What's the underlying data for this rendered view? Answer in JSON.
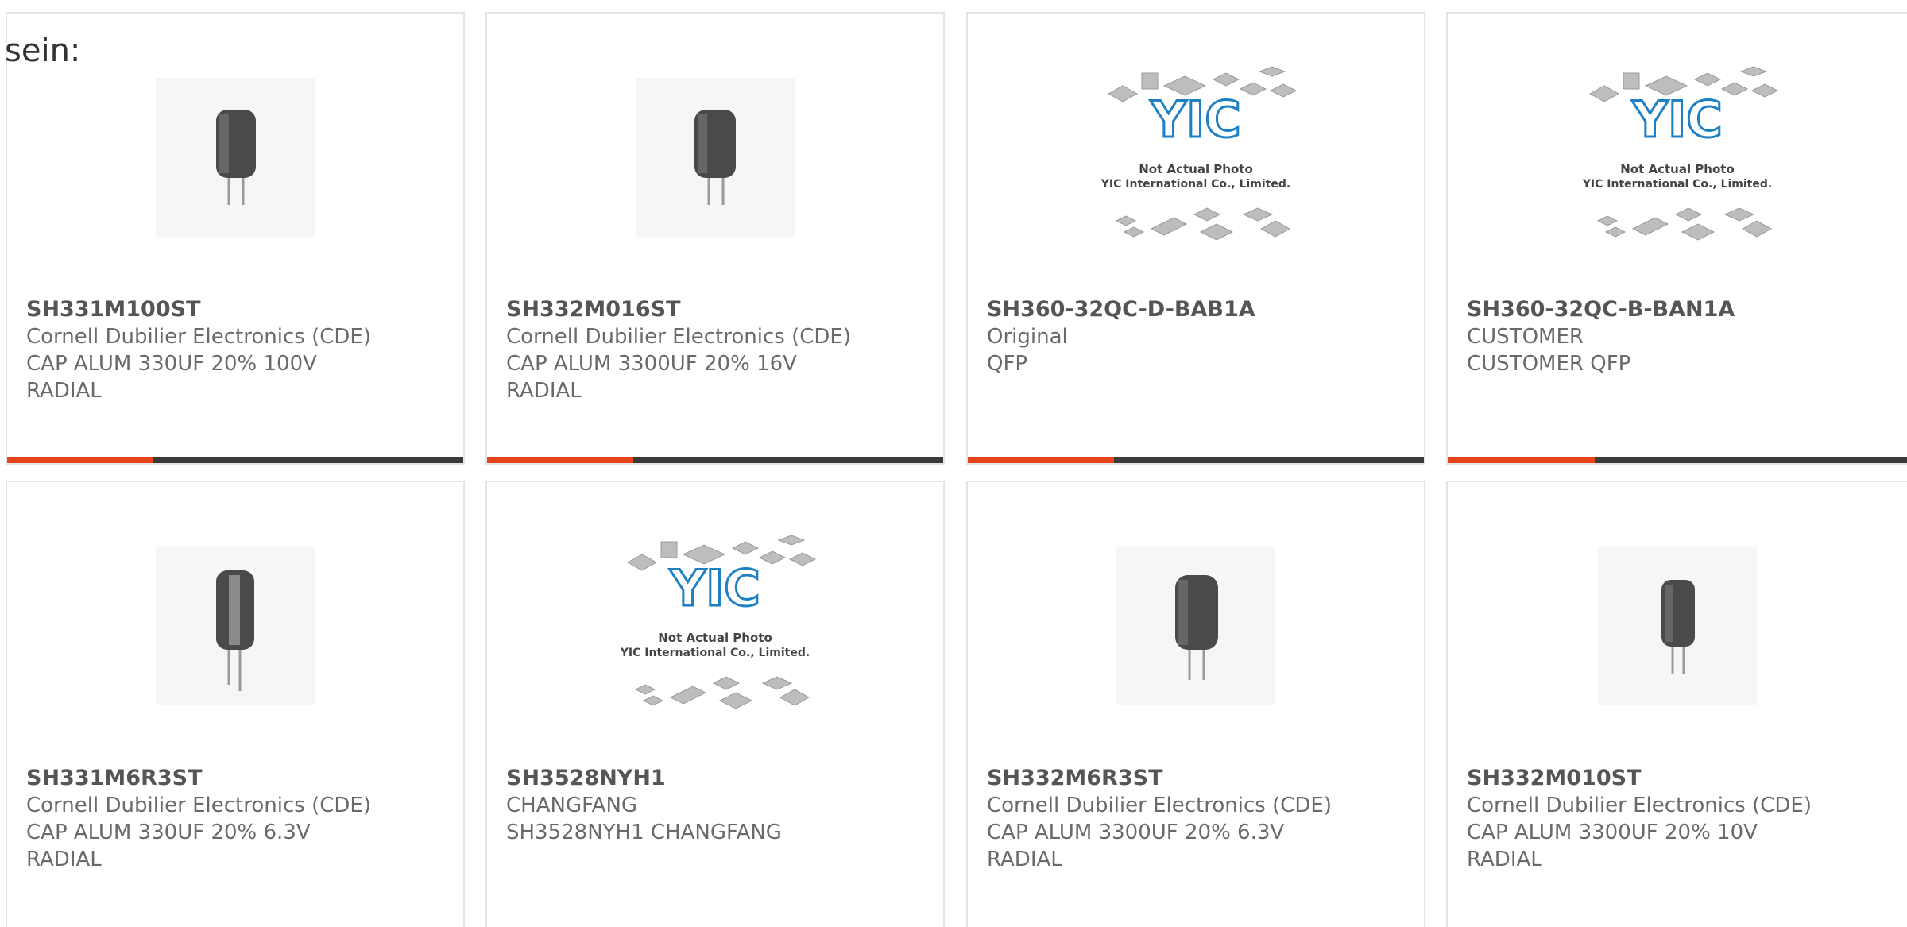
{
  "page": {
    "heading": "sein:"
  },
  "colors": {
    "accent": "#e8441a",
    "bar": "#3b3b3b",
    "border": "#e4e4e4",
    "logo_blue": "#1d7fc4"
  },
  "products": [
    {
      "part": "SH331M100ST",
      "manufacturer": "Cornell Dubilier Electronics (CDE)",
      "description": "CAP ALUM 330UF 20% 100V",
      "package": "RADIAL",
      "image": "capacitor-image"
    },
    {
      "part": "SH332M016ST",
      "manufacturer": "Cornell Dubilier Electronics (CDE)",
      "description": "CAP ALUM 3300UF 20% 16V",
      "package": "RADIAL",
      "image": "capacitor-image"
    },
    {
      "part": "SH360-32QC-D-BAB1A",
      "manufacturer": "Original",
      "description": "QFP",
      "package": "",
      "image": "placeholder-image",
      "placeholder_line1": "Not Actual Photo",
      "placeholder_line2": "YIC International Co., Limited."
    },
    {
      "part": "SH360-32QC-B-BAN1A",
      "manufacturer": "CUSTOMER",
      "description": "CUSTOMER QFP",
      "package": "",
      "image": "placeholder-image",
      "placeholder_line1": "Not Actual Photo",
      "placeholder_line2": "YIC International Co., Limited."
    },
    {
      "part": "SH331M6R3ST",
      "manufacturer": "Cornell Dubilier Electronics (CDE)",
      "description": "CAP ALUM 330UF 20% 6.3V",
      "package": "RADIAL",
      "image": "capacitor-image"
    },
    {
      "part": "SH3528NYH1",
      "manufacturer": "CHANGFANG",
      "description": "SH3528NYH1 CHANGFANG",
      "package": "",
      "image": "placeholder-image",
      "placeholder_line1": "Not Actual Photo",
      "placeholder_line2": "YIC International Co., Limited."
    },
    {
      "part": "SH332M6R3ST",
      "manufacturer": "Cornell Dubilier Electronics (CDE)",
      "description": "CAP ALUM 3300UF 20% 6.3V",
      "package": "RADIAL",
      "image": "capacitor-image"
    },
    {
      "part": "SH332M010ST",
      "manufacturer": "Cornell Dubilier Electronics (CDE)",
      "description": "CAP ALUM 3300UF 20% 10V",
      "package": "RADIAL",
      "image": "capacitor-image"
    }
  ]
}
